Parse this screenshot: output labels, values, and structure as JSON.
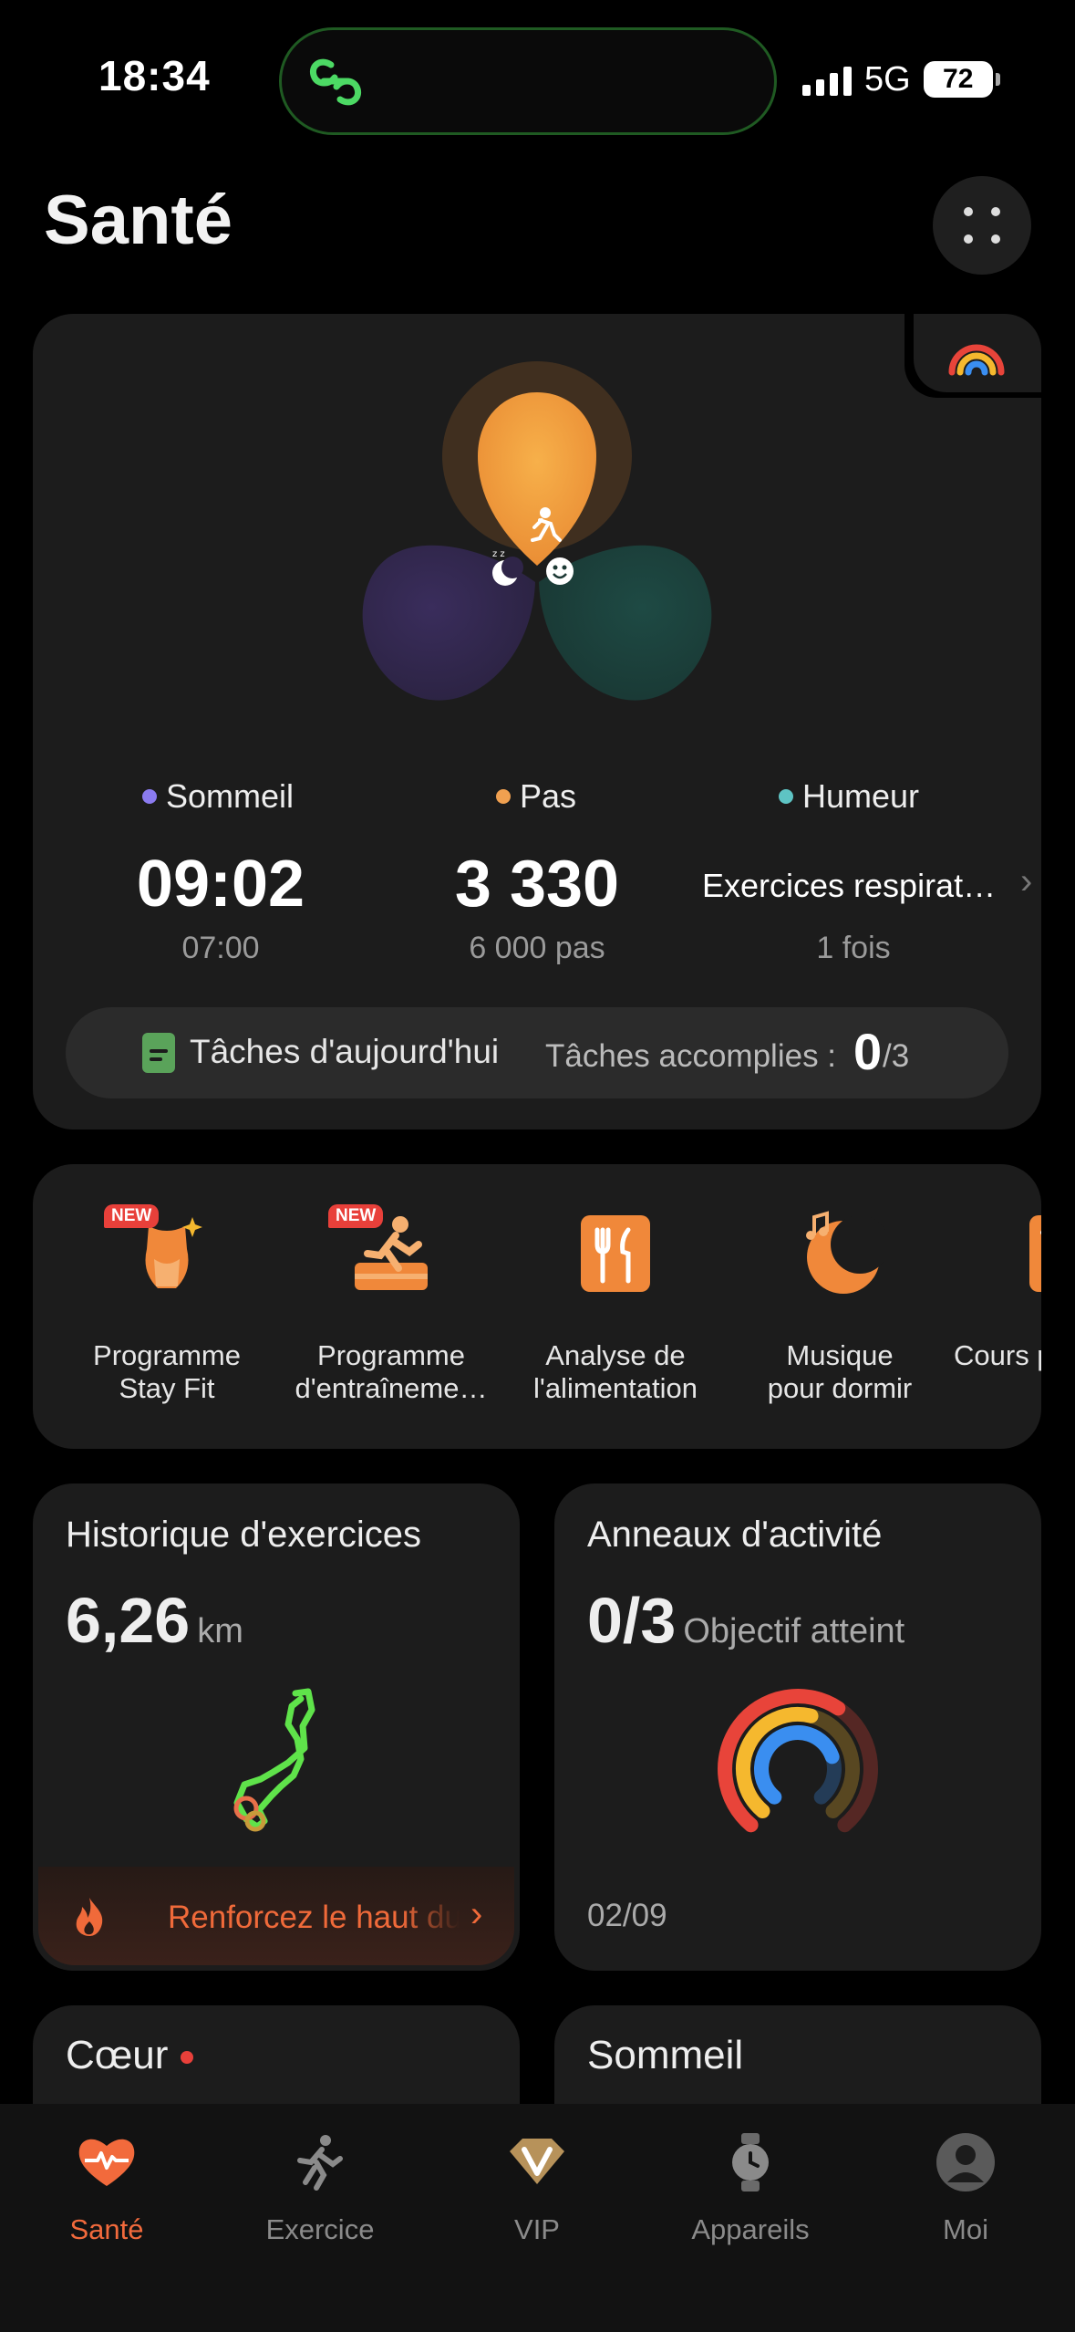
{
  "status_bar": {
    "time": "18:34",
    "network": "5G",
    "battery": "72"
  },
  "header": {
    "title": "Santé"
  },
  "summary": {
    "sleep": {
      "label": "Sommeil",
      "value": "09:02",
      "goal": "07:00",
      "color": "#8b7bf0"
    },
    "steps": {
      "label": "Pas",
      "value": "3 330",
      "goal": "6 000 pas",
      "color": "#f0a050"
    },
    "mood": {
      "label": "Humeur",
      "value": "Exercices respirat…",
      "sub": "1 fois",
      "color": "#5ec4c4"
    },
    "tasks": {
      "title": "Tâches d'aujourd'hui",
      "done_label": "Tâches accomplies :",
      "done": "0",
      "total": "/3"
    }
  },
  "programs": [
    {
      "label": "Programme\nStay Fit",
      "badge": "NEW",
      "icon": "body-shape-icon"
    },
    {
      "label": "Programme\nd'entraîneme…",
      "badge": "NEW",
      "icon": "running-program-icon"
    },
    {
      "label": "Analyse de\nl'alimentation",
      "badge": "",
      "icon": "fork-knife-icon"
    },
    {
      "label": "Musique\npour dormir",
      "badge": "",
      "icon": "moon-music-icon"
    },
    {
      "label": "Cours p",
      "badge": "",
      "icon": "course-icon"
    }
  ],
  "exercise_history": {
    "title": "Historique d'exercices",
    "distance": "6,26",
    "unit": "km",
    "tip": "Renforcez le haut du corps"
  },
  "activity_rings": {
    "title": "Anneaux d'activité",
    "achieved": "0/3",
    "label": "Objectif atteint",
    "date": "02/09",
    "rings": [
      {
        "color": "#e8443a",
        "fraction": 0.62
      },
      {
        "color": "#f5b82e",
        "fraction": 0.55
      },
      {
        "color": "#3a8ef0",
        "fraction": 0.75
      }
    ]
  },
  "heart": {
    "title": "Cœur"
  },
  "sleep_card": {
    "title": "Sommeil"
  },
  "tabs": [
    {
      "label": "Santé",
      "icon": "heart-pulse-icon",
      "active": true
    },
    {
      "label": "Exercice",
      "icon": "runner-icon",
      "active": false
    },
    {
      "label": "VIP",
      "icon": "vip-diamond-icon",
      "active": false
    },
    {
      "label": "Appareils",
      "icon": "watch-icon",
      "active": false
    },
    {
      "label": "Moi",
      "icon": "user-avatar-icon",
      "active": false
    }
  ],
  "colors": {
    "accent": "#f26a3c",
    "card": "#1c1c1c",
    "background": "#000000"
  }
}
